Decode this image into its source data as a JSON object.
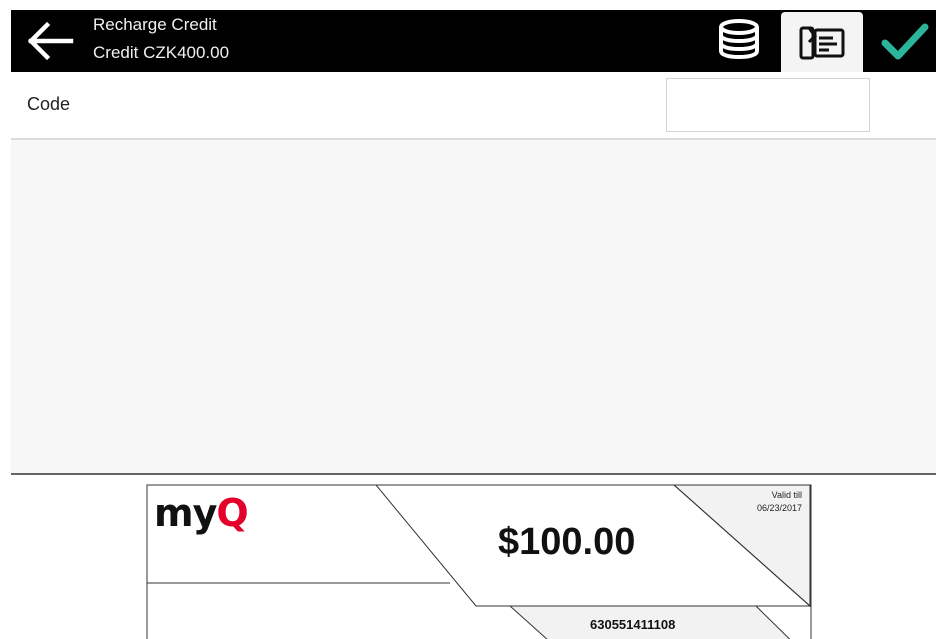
{
  "header": {
    "title": "Recharge Credit",
    "subtitle": "Credit CZK400.00"
  },
  "icons": {
    "back": "arrow-left-icon",
    "coins": "coins-stack-icon",
    "voucher": "voucher-card-icon",
    "confirm": "check-icon"
  },
  "colors": {
    "header_bg": "#000000",
    "confirm_green": "#2bb59a",
    "logo_red": "#e4002b"
  },
  "form": {
    "code_label": "Code",
    "code_value": ""
  },
  "voucher": {
    "logo_my": "my",
    "logo_q": "Q",
    "amount": "$100.00",
    "valid_label": "Valid till",
    "valid_date": "06/23/2017",
    "serial": "630551411108"
  }
}
